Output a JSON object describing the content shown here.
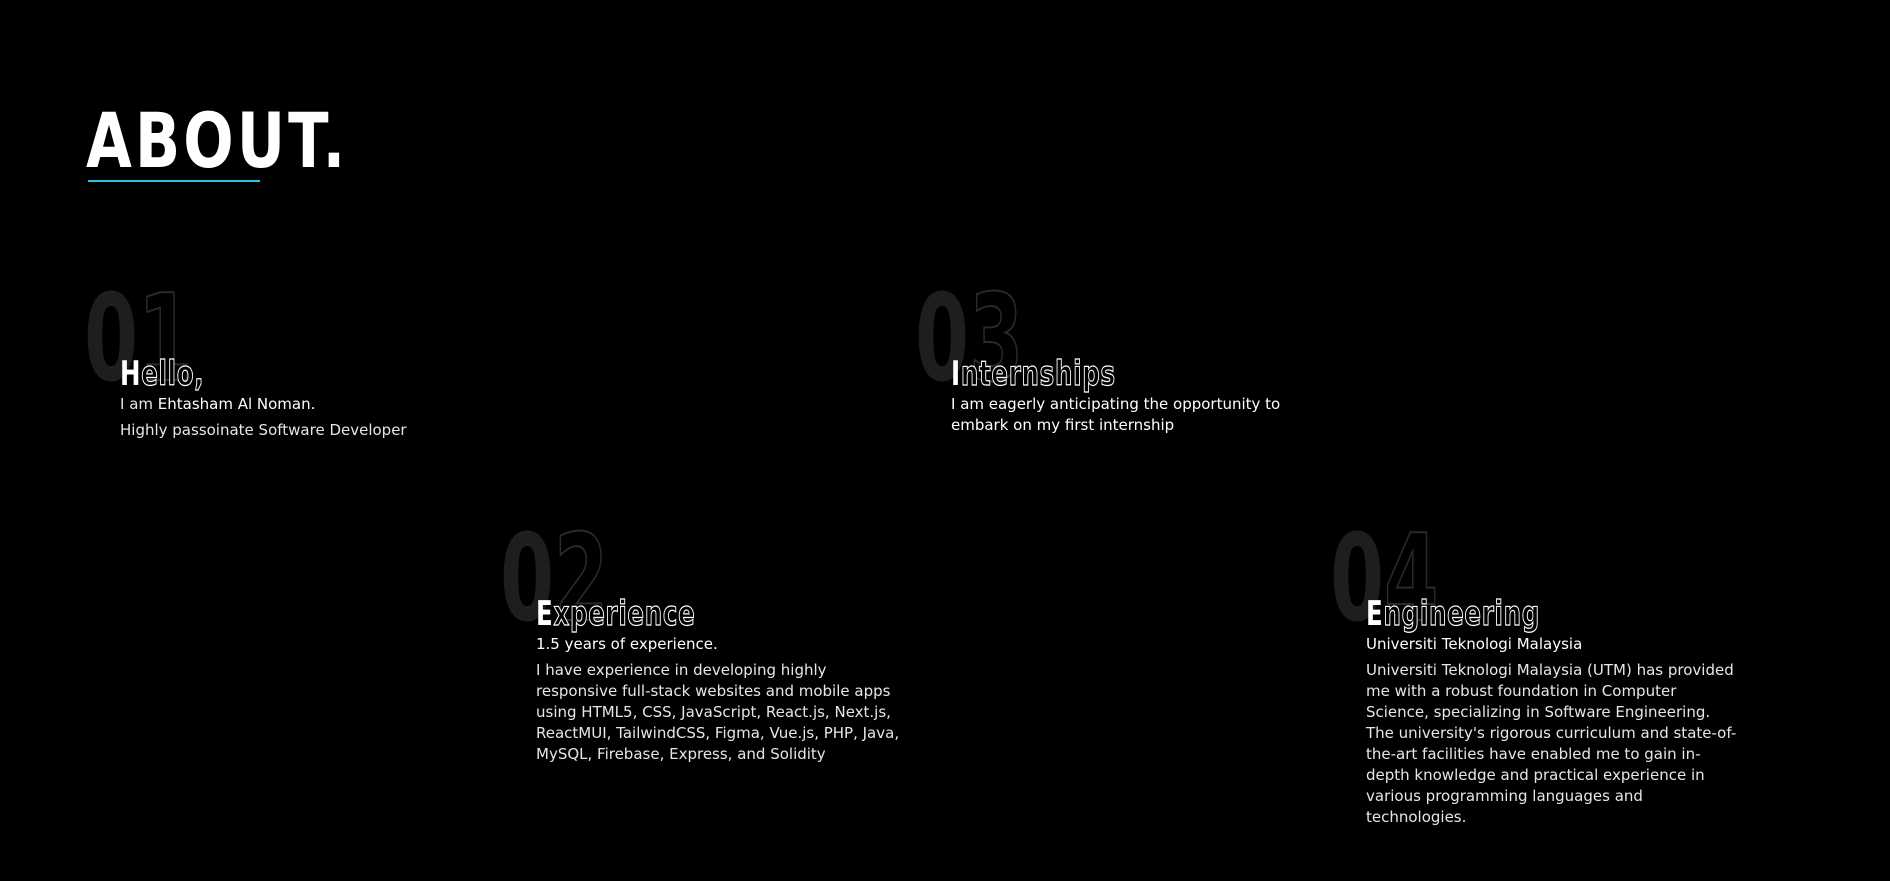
{
  "section": {
    "heading": "ABOUT.",
    "accent_color": "#2bc4e4"
  },
  "cards": [
    {
      "number_solid": "0",
      "number_outline": "1",
      "title_first": "H",
      "title_rest": "ello,",
      "intro_prefix": "I am ",
      "intro_name": "Ehtasham Al Noman.",
      "desc": "Highly passoinate Software Developer"
    },
    {
      "number_solid": "0",
      "number_outline": "2",
      "title_first": "E",
      "title_rest": "xperience",
      "subtitle": "1.5 years of experience.",
      "desc": "I have experience in developing highly responsive full-stack websites and mobile apps using HTML5, CSS, JavaScript, React.js, Next.js, ReactMUI, TailwindCSS, Figma, Vue.js, PHP, Java, MySQL, Firebase, Express, and Solidity"
    },
    {
      "number_solid": "0",
      "number_outline": "3",
      "title_first": "I",
      "title_rest": "nternships",
      "subtitle": "I am eagerly anticipating the opportunity to embark on my first internship"
    },
    {
      "number_solid": "0",
      "number_outline": "4",
      "title_first": "E",
      "title_rest": "ngineering",
      "subtitle": "Universiti Teknologi Malaysia",
      "desc": "Universiti Teknologi Malaysia (UTM) has provided me with a robust foundation in Computer Science, specializing in Software Engineering. The university's rigorous curriculum and state-of-the-art facilities have enabled me to gain in-depth knowledge and practical experience in various programming languages and technologies."
    }
  ]
}
